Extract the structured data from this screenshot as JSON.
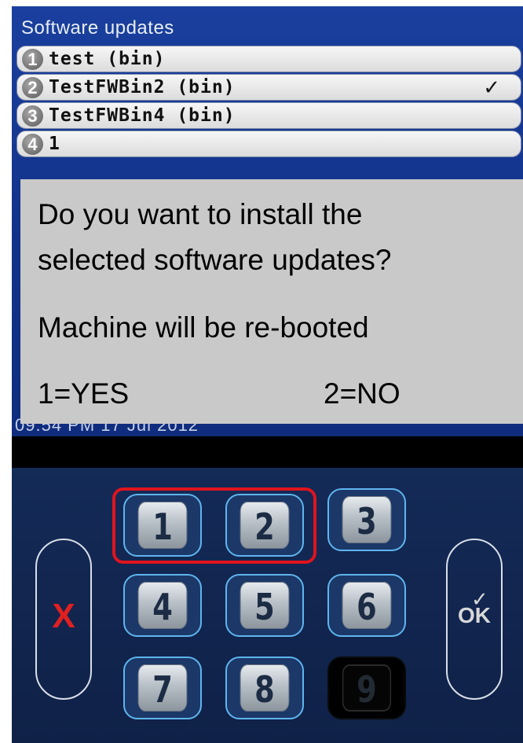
{
  "screen": {
    "title": "Software updates",
    "updates": [
      {
        "num": "1",
        "label": "test  (bin)",
        "checked": false
      },
      {
        "num": "2",
        "label": "TestFWBin2  (bin)",
        "checked": true
      },
      {
        "num": "3",
        "label": "TestFWBin4  (bin)",
        "checked": false
      },
      {
        "num": "4",
        "label": "1",
        "checked": false
      }
    ],
    "check_mark": "✓",
    "timestamp": "09:54 PM 17 Jul 2012"
  },
  "dialog": {
    "line1": "Do you want to install the",
    "line2": "selected software updates?",
    "line3": "Machine will be re-booted",
    "yes_option": "1=YES",
    "no_option": "2=NO"
  },
  "keypad": {
    "keys": [
      "1",
      "2",
      "3",
      "4",
      "5",
      "6",
      "7",
      "8",
      "9"
    ],
    "disabled_keys": [
      "9"
    ],
    "cancel_label": "X",
    "ok_label": "OK",
    "ok_tick": "✓",
    "highlighted_keys": [
      "1",
      "2"
    ]
  },
  "colors": {
    "screen_blue": "#123289",
    "highlight_red": "#e0141e",
    "key_border": "#5fb5ef"
  }
}
